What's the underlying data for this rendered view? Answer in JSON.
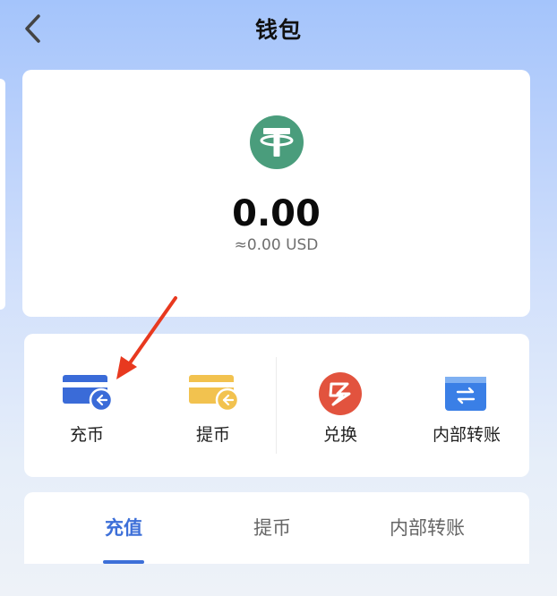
{
  "header": {
    "title": "钱包",
    "back_icon": "chevron-left-icon"
  },
  "balance": {
    "coin_icon": "tether-icon",
    "amount": "0.00",
    "usd_equivalent": "≈0.00 USD",
    "coin_color": "#4a9d7c"
  },
  "actions": [
    {
      "label": "充币",
      "icon": "deposit-card-icon",
      "color": "#3a6bd8"
    },
    {
      "label": "提币",
      "icon": "withdraw-card-icon",
      "color": "#f2c24f"
    },
    {
      "label": "兑换",
      "icon": "exchange-icon",
      "color": "#e2533e"
    },
    {
      "label": "内部转账",
      "icon": "internal-transfer-icon",
      "color": "#3a7fe6"
    }
  ],
  "tabs": [
    {
      "label": "充值",
      "active": true
    },
    {
      "label": "提币",
      "active": false
    },
    {
      "label": "内部转账",
      "active": false
    }
  ],
  "colors": {
    "accent": "#3d6fd8",
    "annotation_arrow": "#e8391f"
  }
}
